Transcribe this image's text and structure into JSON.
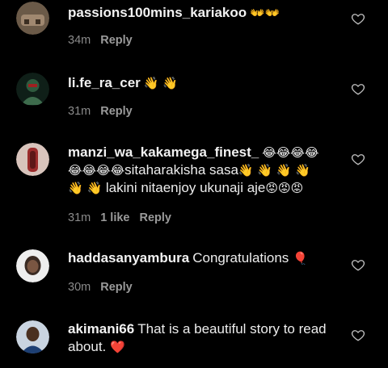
{
  "comments": [
    {
      "username": "passions100mins_kariakoo",
      "text": "",
      "emoji": "👐👐",
      "time": "34m",
      "likes": "",
      "reply": "Reply",
      "avatar_color": "#6b5a48"
    },
    {
      "username": "li.fe_ra_cer",
      "text": "",
      "emoji": "👋 👋",
      "time": "31m",
      "likes": "",
      "reply": "Reply",
      "avatar_color": "#1f3a2c"
    },
    {
      "username": "manzi_wa_kakamega_finest_",
      "text_line1_emoji_a": "😂😂😂😂",
      "text_line2_emoji": "😂😂😂😂",
      "text_line2": "sitaharakisha sasa",
      "text_line2_emoji_b": "👋 👋 👋 👋",
      "text_line3_emoji": "👋 👋",
      "text_line3": "lakini nitaenjoy ukunaji aje",
      "text_line3_emoji_b": "😡😡😡",
      "time": "31m",
      "likes": "1 like",
      "reply": "Reply",
      "avatar_color": "#c8b0a8"
    },
    {
      "username": "haddasanyambura",
      "text": "Congratulations",
      "emoji": "🎈",
      "time": "30m",
      "likes": "",
      "reply": "Reply",
      "avatar_color": "#e9e9e9"
    },
    {
      "username": "akimani66",
      "text": "That is a beautiful story to read about.",
      "emoji": "❤️",
      "time": "",
      "likes": "",
      "reply": "",
      "avatar_color": "#2a4a7a"
    }
  ],
  "icons": {
    "like": "heart-outline-icon"
  }
}
